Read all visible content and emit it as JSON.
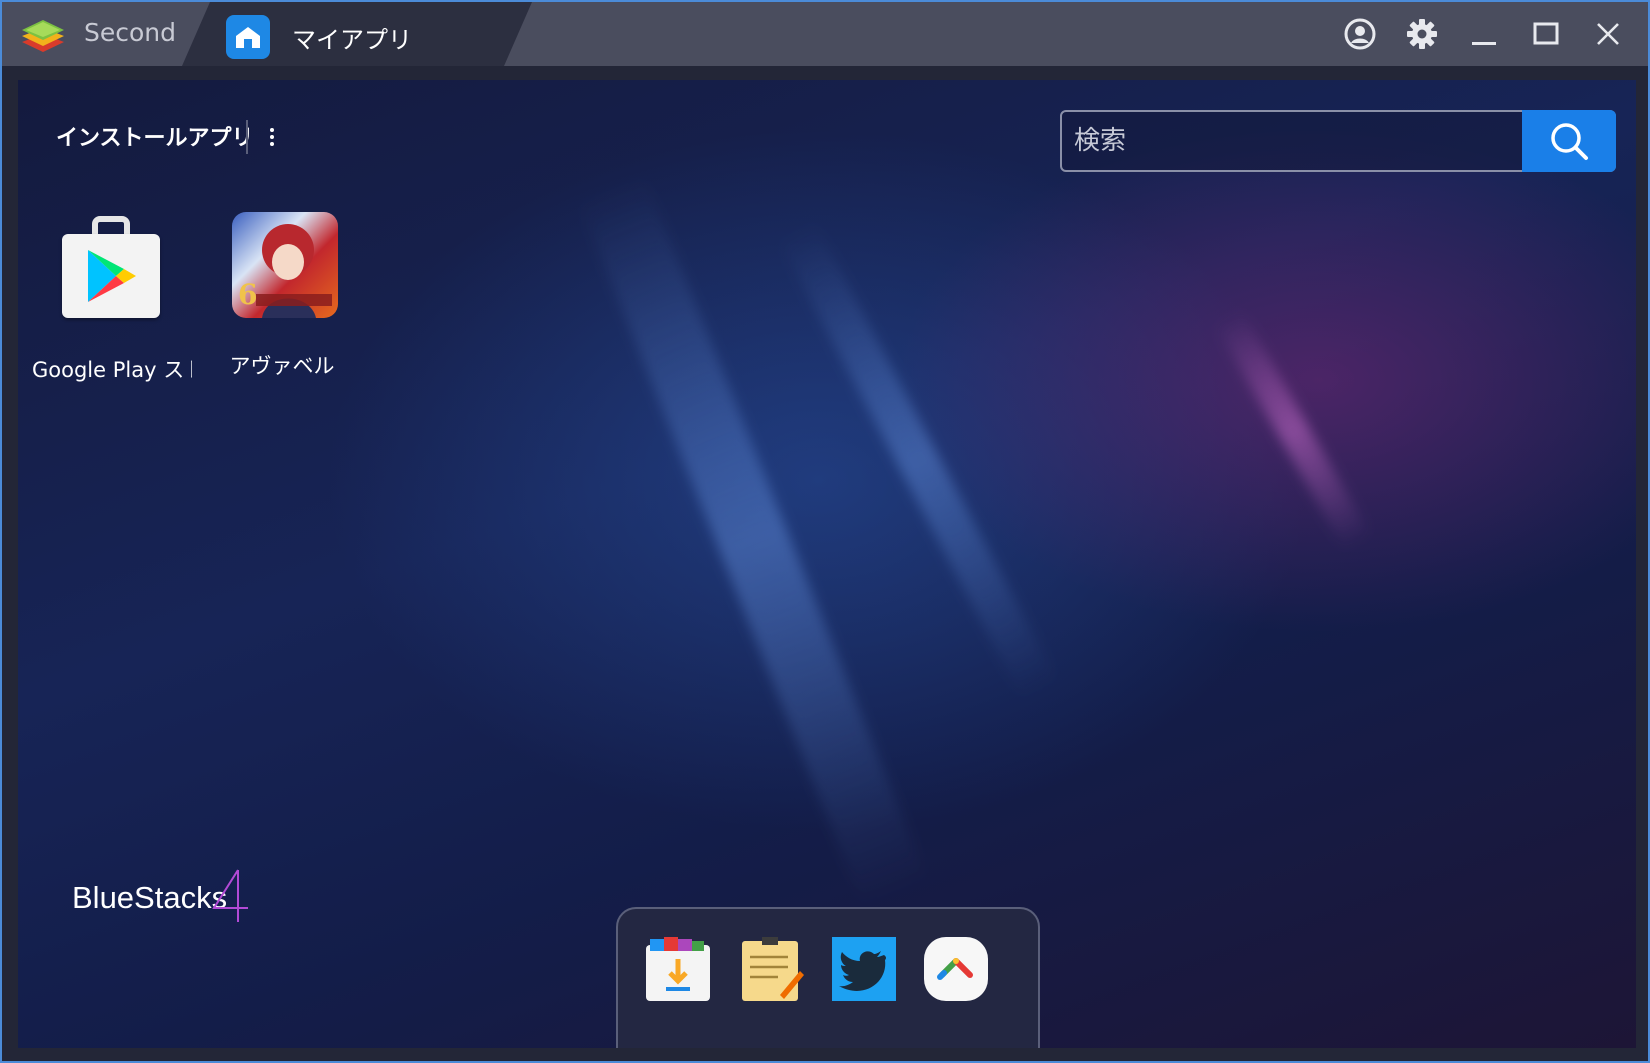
{
  "titlebar": {
    "tab_second_label": "Second",
    "tab_active_label": "マイアプリ",
    "icons": [
      "account-icon",
      "settings-gear-icon",
      "minimize-icon",
      "maximize-icon",
      "close-icon"
    ]
  },
  "header": {
    "title": "インストールアプリ",
    "menu_icon": "kebab-menu-icon"
  },
  "search": {
    "placeholder": "検索",
    "button_icon": "search-icon"
  },
  "apps": [
    {
      "label": "Google Play ストア",
      "icon": "google-play-store-icon"
    },
    {
      "label": "アヴァベル",
      "icon": "avabel-game-icon"
    }
  ],
  "brand": {
    "name": "BlueStacks",
    "version": "4"
  },
  "dock": {
    "items": [
      "app-center-icon",
      "notes-icon",
      "twitter-icon",
      "more-apps-icon"
    ]
  },
  "colors": {
    "accent_blue": "#1a7fe8",
    "titlebar": "#4a4d5e",
    "background": "#172456",
    "brand_purple": "#b24ad6"
  }
}
